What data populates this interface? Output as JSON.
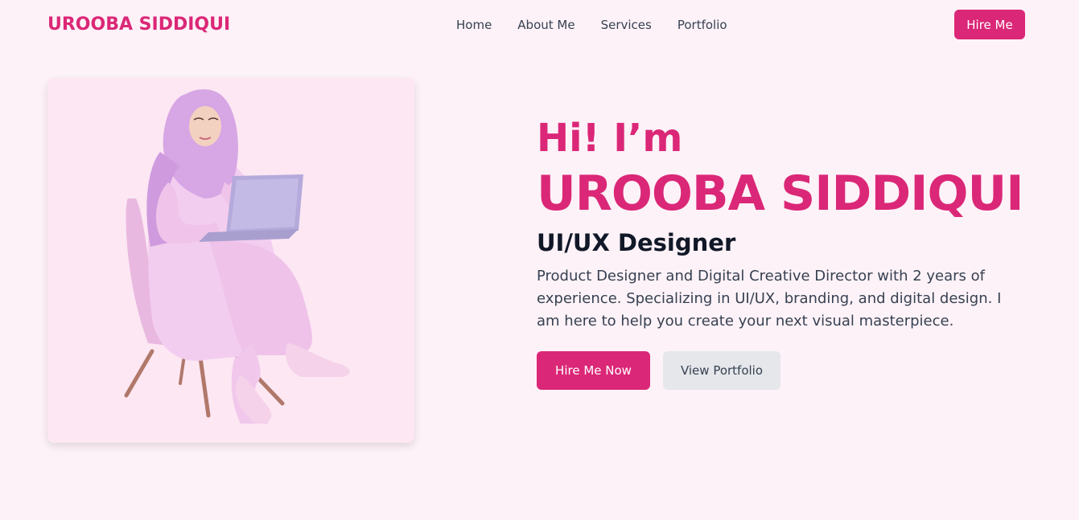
{
  "nav": {
    "brand": "UROOBA SIDDIQUI",
    "links": [
      "Home",
      "About Me",
      "Services",
      "Portfolio"
    ],
    "cta": "Hire Me"
  },
  "hero": {
    "greeting": "Hi! I’m",
    "name": "UROOBA SIDDIQUI",
    "role": "UI/UX Designer",
    "description": "Product Designer and Digital Creative Director with 2 years of experience. Specializing in UI/UX, branding, and digital design. I am here to help you create your next visual masterpiece.",
    "primary_button": "Hire Me Now",
    "secondary_button": "View Portfolio"
  },
  "colors": {
    "accent": "#db2777",
    "background": "#fdf2f8",
    "card": "#fce7f3",
    "secondary_button": "#e5e7eb"
  }
}
